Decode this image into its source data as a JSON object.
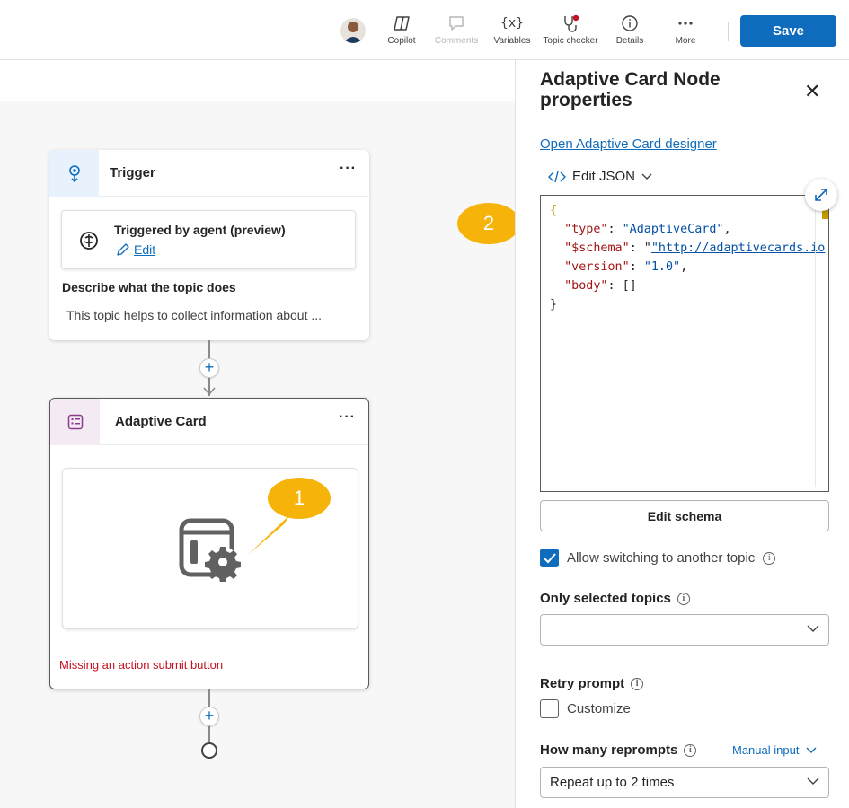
{
  "toolbar": {
    "items": [
      {
        "label": "Copilot",
        "icon": "copilot-icon",
        "disabled": false
      },
      {
        "label": "Comments",
        "icon": "comment-icon",
        "disabled": true
      },
      {
        "label": "Variables",
        "icon": "variables-icon",
        "disabled": false
      },
      {
        "label": "Topic checker",
        "icon": "stethoscope-icon",
        "disabled": false
      },
      {
        "label": "Details",
        "icon": "info-icon",
        "disabled": false
      },
      {
        "label": "More",
        "icon": "more-icon",
        "disabled": false
      }
    ],
    "variables_glyph": "{x}",
    "save_label": "Save"
  },
  "canvas": {
    "trigger_node": {
      "title": "Trigger",
      "more": "···",
      "triggered_by": "Triggered by agent (preview)",
      "edit_label": "Edit",
      "describe_label": "Describe what the topic does",
      "description": "This topic helps to collect information about ..."
    },
    "adaptive_node": {
      "title": "Adaptive Card",
      "more": "···",
      "error": "Missing an action submit button"
    },
    "plus": "+",
    "callouts": {
      "one": "1",
      "two": "2"
    }
  },
  "panel": {
    "title": "Adaptive Card Node properties",
    "close": "✕",
    "designer_link": "Open Adaptive Card designer",
    "edit_json_label": "Edit JSON",
    "json_lines": {
      "open": "{",
      "type_key": "\"type\"",
      "type_val": "\"AdaptiveCard\"",
      "schema_key": "\"$schema\"",
      "schema_val": "\"http://adaptivecards.io",
      "version_key": "\"version\"",
      "version_val": "\"1.0\"",
      "body_key": "\"body\"",
      "body_val": "[]",
      "close": "}"
    },
    "edit_schema_label": "Edit schema",
    "allow_switching": {
      "label": "Allow switching to another topic",
      "checked": true
    },
    "only_selected_label": "Only selected topics",
    "only_selected_value": "",
    "retry_prompt_label": "Retry prompt",
    "customize": {
      "label": "Customize",
      "checked": false
    },
    "reprompts_label": "How many reprompts",
    "manual_input_label": "Manual input",
    "reprompts_value": "Repeat up to 2 times"
  },
  "colors": {
    "accent": "#0f6cbd",
    "callout": "#f6b40b",
    "error": "#c50f1f"
  }
}
